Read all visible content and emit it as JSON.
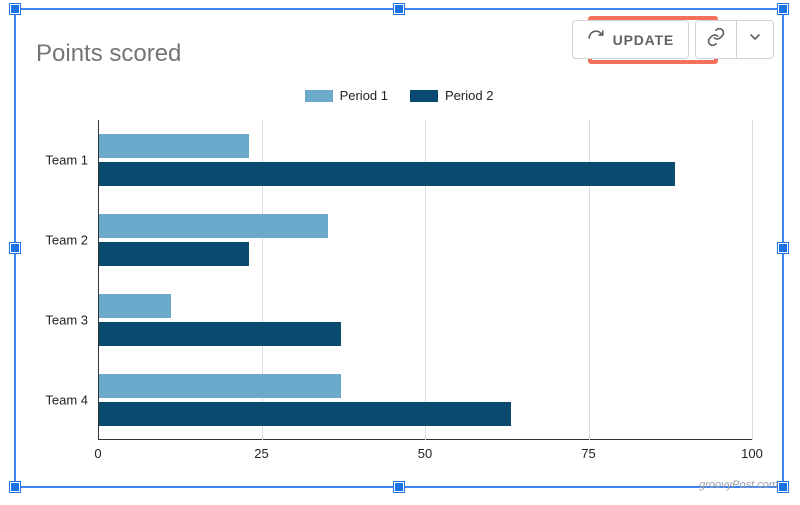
{
  "toolbar": {
    "update_label": "UPDATE"
  },
  "watermark": "groovyPost.com",
  "chart_data": {
    "type": "bar",
    "orientation": "horizontal",
    "title": "Points scored",
    "xlabel": "",
    "ylabel": "",
    "xlim": [
      0,
      100
    ],
    "x_ticks": [
      0,
      25,
      50,
      75,
      100
    ],
    "categories": [
      "Team 1",
      "Team 2",
      "Team 3",
      "Team 4"
    ],
    "series": [
      {
        "name": "Period 1",
        "color": "#6caacb",
        "values": [
          23,
          35,
          11,
          37
        ]
      },
      {
        "name": "Period 2",
        "color": "#0b4a6f",
        "values": [
          88,
          23,
          37,
          63
        ]
      }
    ],
    "legend_position": "top"
  }
}
